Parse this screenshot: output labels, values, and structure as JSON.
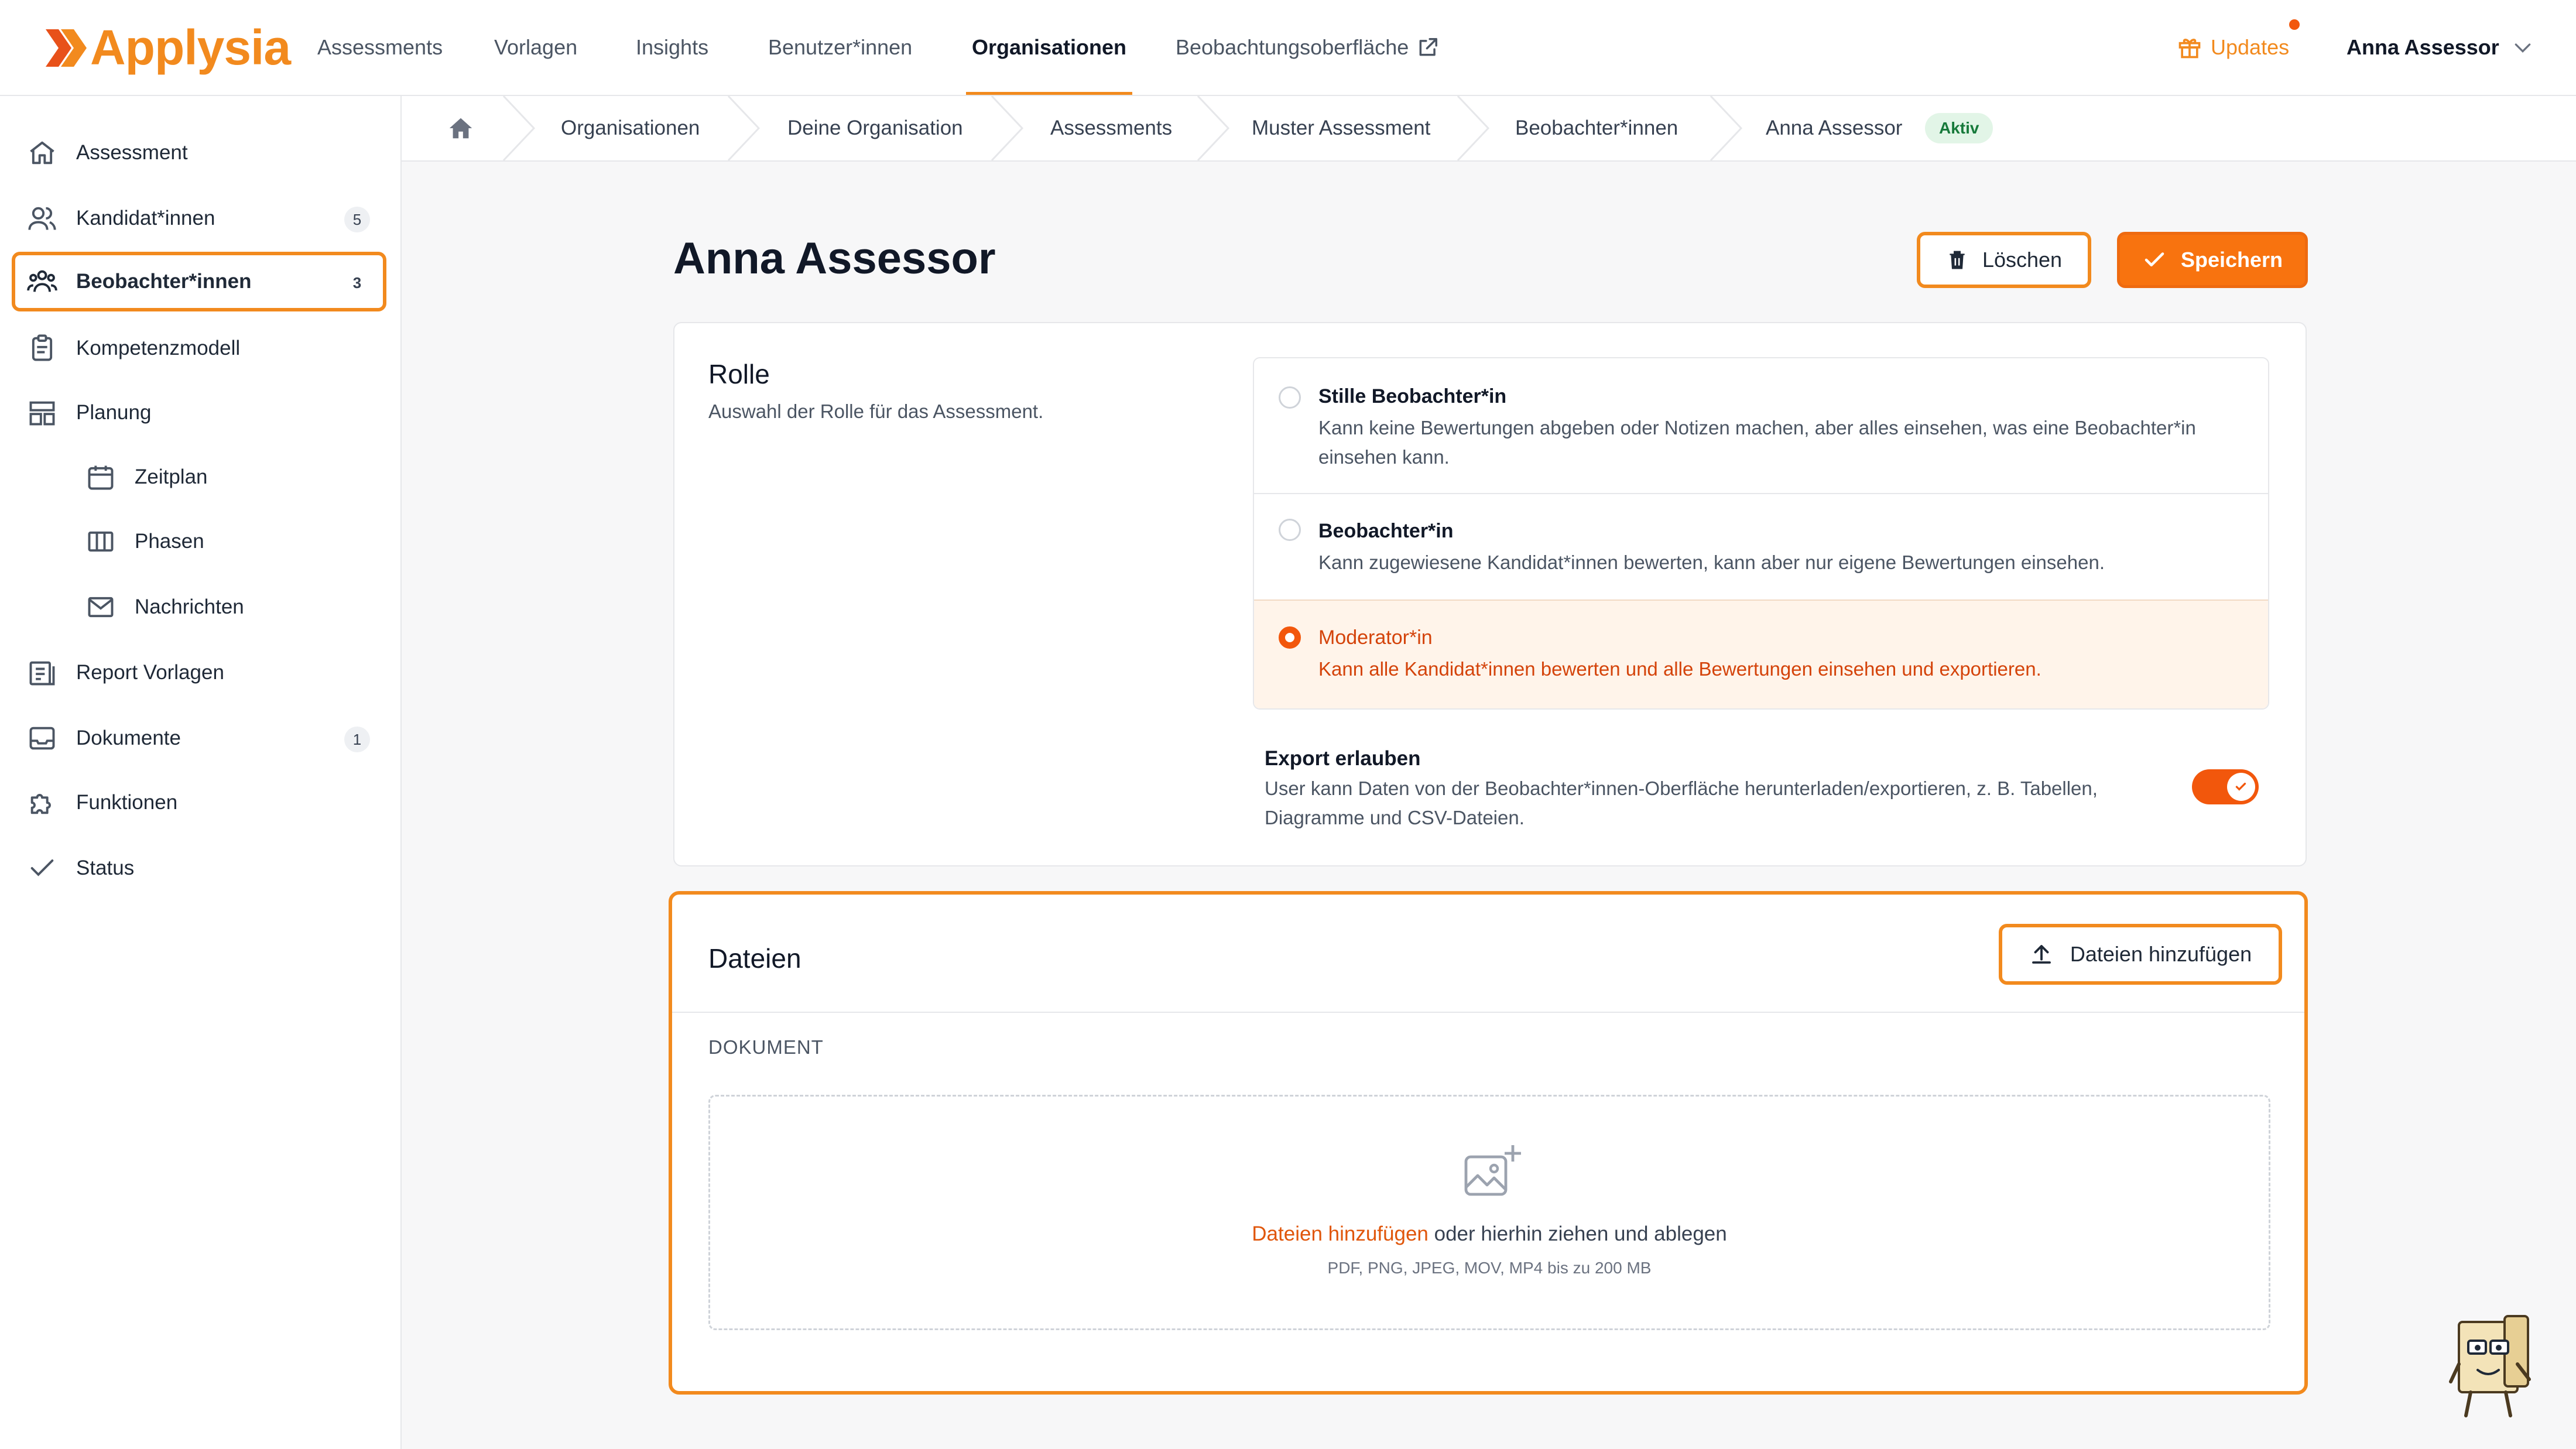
{
  "brand": {
    "name": "Applysia",
    "accent": "#f28a1e",
    "primary": "#f8730f"
  },
  "topnav": {
    "items": [
      "Assessments",
      "Vorlagen",
      "Insights",
      "Benutzer*innen",
      "Organisationen",
      "Beobachtungsoberfläche"
    ],
    "active": "Organisationen",
    "external_icon": "external-link-icon",
    "updates_label": "Updates",
    "updates_icon": "gift-icon",
    "user_name": "Anna Assessor"
  },
  "sidebar": {
    "items": [
      {
        "label": "Assessment",
        "icon": "home-icon"
      },
      {
        "label": "Kandidat*innen",
        "icon": "users-icon",
        "badge": "5"
      },
      {
        "label": "Beobachter*innen",
        "icon": "user-group-icon",
        "badge": "3"
      },
      {
        "label": "Kompetenzmodell",
        "icon": "clipboard-icon"
      },
      {
        "label": "Planung",
        "icon": "layout-icon"
      },
      {
        "label": "Zeitplan",
        "icon": "calendar-icon"
      },
      {
        "label": "Phasen",
        "icon": "columns-icon"
      },
      {
        "label": "Nachrichten",
        "icon": "mail-icon"
      },
      {
        "label": "Report Vorlagen",
        "icon": "report-icon"
      },
      {
        "label": "Dokumente",
        "icon": "inbox-icon",
        "badge": "1"
      },
      {
        "label": "Funktionen",
        "icon": "puzzle-icon"
      },
      {
        "label": "Status",
        "icon": "check-icon"
      }
    ],
    "active": "Beobachter*innen"
  },
  "breadcrumb": {
    "items": [
      "Organisationen",
      "Deine Organisation",
      "Assessments",
      "Muster Assessment",
      "Beobachter*innen",
      "Anna Assessor"
    ],
    "status": "Aktiv"
  },
  "header": {
    "title": "Anna Assessor",
    "delete_label": "Löschen",
    "save_label": "Speichern"
  },
  "role": {
    "title": "Rolle",
    "description": "Auswahl der Rolle für das Assessment.",
    "options": [
      {
        "title": "Stille Beobachter*in",
        "description": "Kann keine Bewertungen abgeben oder Notizen machen, aber alles einsehen, was eine Beobachter*in einsehen kann.",
        "selected": false
      },
      {
        "title": "Beobachter*in",
        "description": "Kann zugewiesene Kandidat*innen bewerten, kann aber nur eigene Bewertungen einsehen.",
        "selected": false
      },
      {
        "title": "Moderator*in",
        "description": "Kann alle Kandidat*innen bewerten und alle Bewertungen einsehen und exportieren.",
        "selected": true
      }
    ],
    "export": {
      "title": "Export erlauben",
      "description": "User kann Daten von der Beobachter*innen-Oberfläche herunterladen/exportieren, z. B. Tabellen, Diagramme und CSV-Dateien.",
      "enabled": true
    }
  },
  "files": {
    "title": "Dateien",
    "add_label": "Dateien hinzufügen",
    "column_label": "DOKUMENT",
    "drop_link": "Dateien hinzufügen",
    "drop_text": " oder hierhin ziehen und ablegen",
    "drop_hint": "PDF, PNG, JPEG, MOV, MP4 bis zu 200 MB"
  }
}
